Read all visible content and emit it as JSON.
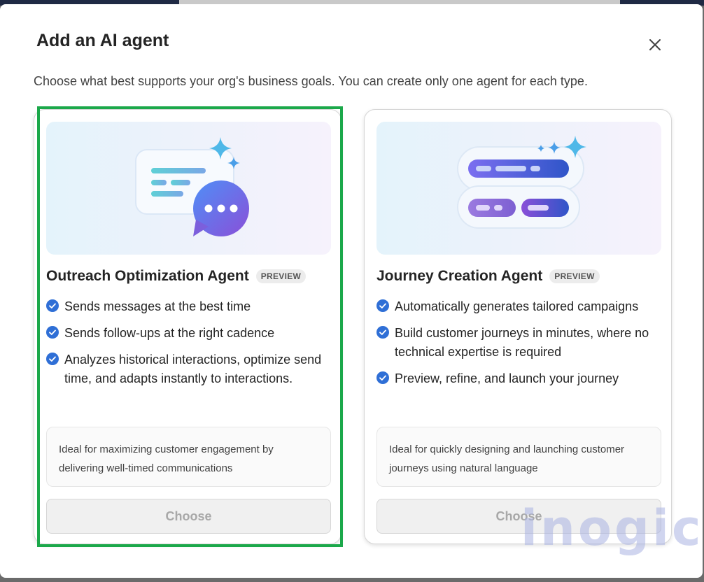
{
  "dialog": {
    "title": "Add an AI agent",
    "subtitle": "Choose what best supports your org's business goals. You can create only one agent for each type.",
    "close_icon": "close-icon"
  },
  "cards": [
    {
      "name": "Outreach Optimization Agent",
      "badge": "PREVIEW",
      "features": [
        "Sends messages at the best time",
        "Sends follow-ups at the right cadence",
        "Analyzes historical interactions, optimize send time, and adapts instantly to interactions."
      ],
      "ideal": "Ideal for maximizing customer engagement by delivering well-timed communications",
      "button": "Choose",
      "selected": true
    },
    {
      "name": "Journey Creation Agent",
      "badge": "PREVIEW",
      "features": [
        "Automatically generates tailored campaigns",
        "Build customer journeys in minutes, where no technical expertise is required",
        "Preview, refine, and launch your journey"
      ],
      "ideal": "Ideal for quickly designing and launching customer journeys using natural language",
      "button": "Choose",
      "selected": false
    }
  ],
  "watermark": "inogic",
  "colors": {
    "accent": "#0f6cbd",
    "selection": "#1ba84a",
    "disabled_text": "#a8a8a8"
  }
}
